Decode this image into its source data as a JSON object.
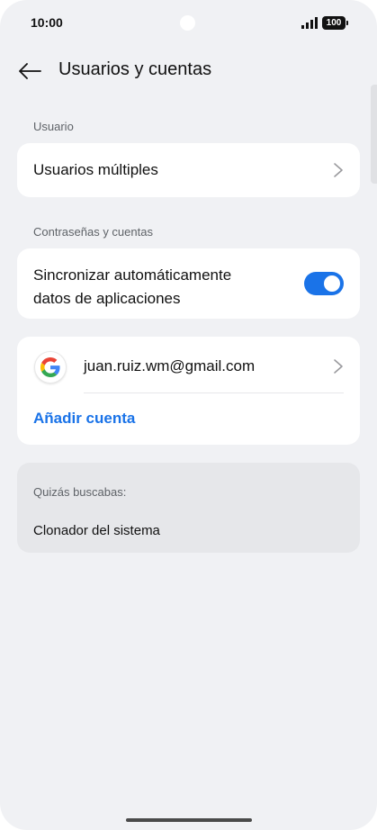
{
  "status_bar": {
    "time": "10:00",
    "battery": "100"
  },
  "header": {
    "title": "Usuarios y cuentas"
  },
  "sections": {
    "user_label": "Usuario",
    "multiple_users": "Usuarios múltiples",
    "passwords_label": "Contraseñas y cuentas",
    "auto_sync_line1": "Sincronizar automáticamente",
    "auto_sync_line2": "datos de aplicaciones",
    "auto_sync_enabled": true
  },
  "accounts": {
    "email": "juan.ruiz.wm@gmail.com",
    "add_account": "Añadir cuenta"
  },
  "suggestions": {
    "label": "Quizás buscabas:",
    "item": "Clonador del sistema"
  },
  "colors": {
    "background": "#f0f1f4",
    "card": "#ffffff",
    "accent": "#1a73e8",
    "suggest_card": "#e6e7ea"
  }
}
